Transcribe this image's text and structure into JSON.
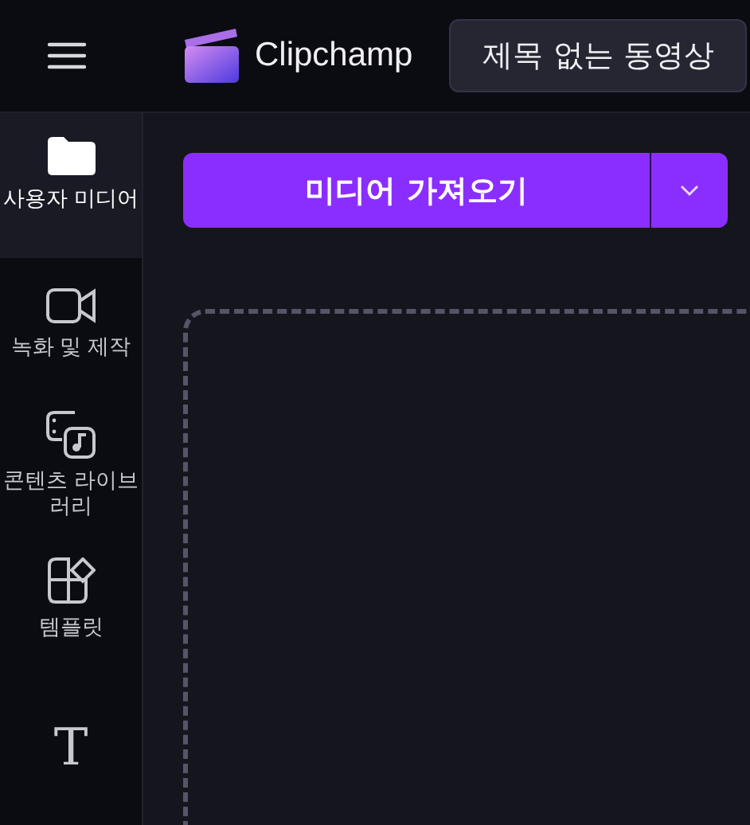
{
  "app": {
    "name": "Clipchamp"
  },
  "project_title": "제목 없는 동영상",
  "sidebar": {
    "items": [
      {
        "kind": "folder",
        "label": "사용자 미디어",
        "selected": true
      },
      {
        "kind": "camera",
        "label": "녹화 및 제작",
        "selected": false
      },
      {
        "kind": "library",
        "label": "콘텐츠 라이브러리",
        "selected": false
      },
      {
        "kind": "templates",
        "label": "템플릿",
        "selected": false
      },
      {
        "kind": "glyph",
        "glyph": "T",
        "selected": false
      }
    ]
  },
  "import_button": {
    "label": "미디어 가져오기"
  }
}
